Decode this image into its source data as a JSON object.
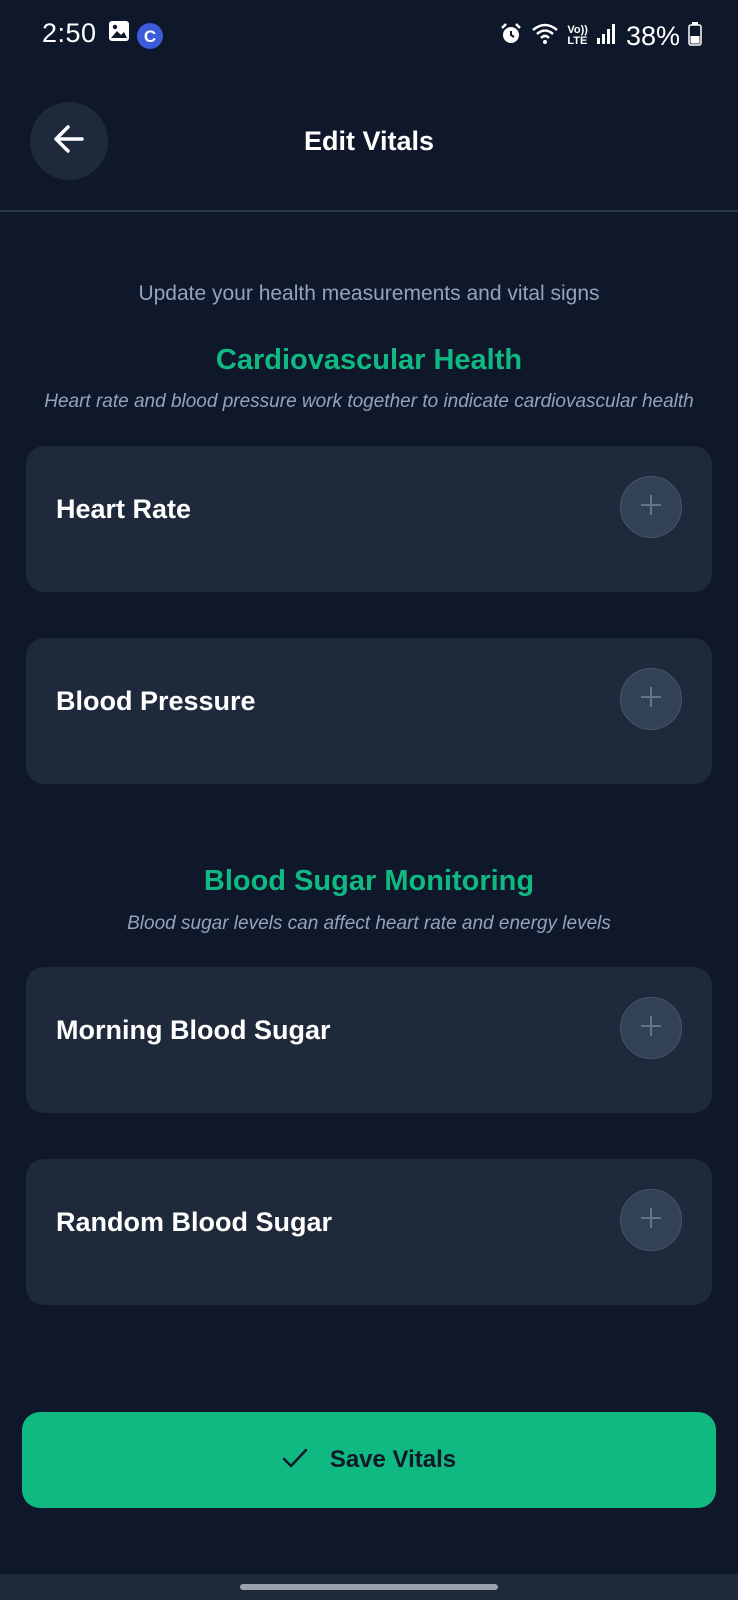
{
  "status_bar": {
    "time": "2:50",
    "battery": "38%",
    "icons": [
      "gallery-icon",
      "c-app-icon",
      "alarm-icon",
      "wifi-icon",
      "volte-icon",
      "signal-icon",
      "battery-icon"
    ],
    "volte_top": "Vo))",
    "volte_bottom": "LTE",
    "app_letter": "C"
  },
  "header": {
    "title": "Edit Vitals",
    "back_icon": "arrow-left-icon"
  },
  "subtitle": "Update your health measurements and vital signs",
  "sections": [
    {
      "title": "Cardiovascular Health",
      "description": "Heart rate and blood pressure work together to indicate cardiovascular health",
      "items": [
        {
          "label": "Heart Rate"
        },
        {
          "label": "Blood Pressure"
        }
      ]
    },
    {
      "title": "Blood Sugar Monitoring",
      "description": "Blood sugar levels can affect heart rate and energy levels",
      "items": [
        {
          "label": "Morning Blood Sugar"
        },
        {
          "label": "Random Blood Sugar"
        }
      ]
    }
  ],
  "save_button": {
    "label": "Save Vitals",
    "icon": "check-icon"
  },
  "colors": {
    "background": "#0f172a",
    "card": "#1e293b",
    "accent": "#10b981",
    "muted_text": "#94a3b8"
  }
}
